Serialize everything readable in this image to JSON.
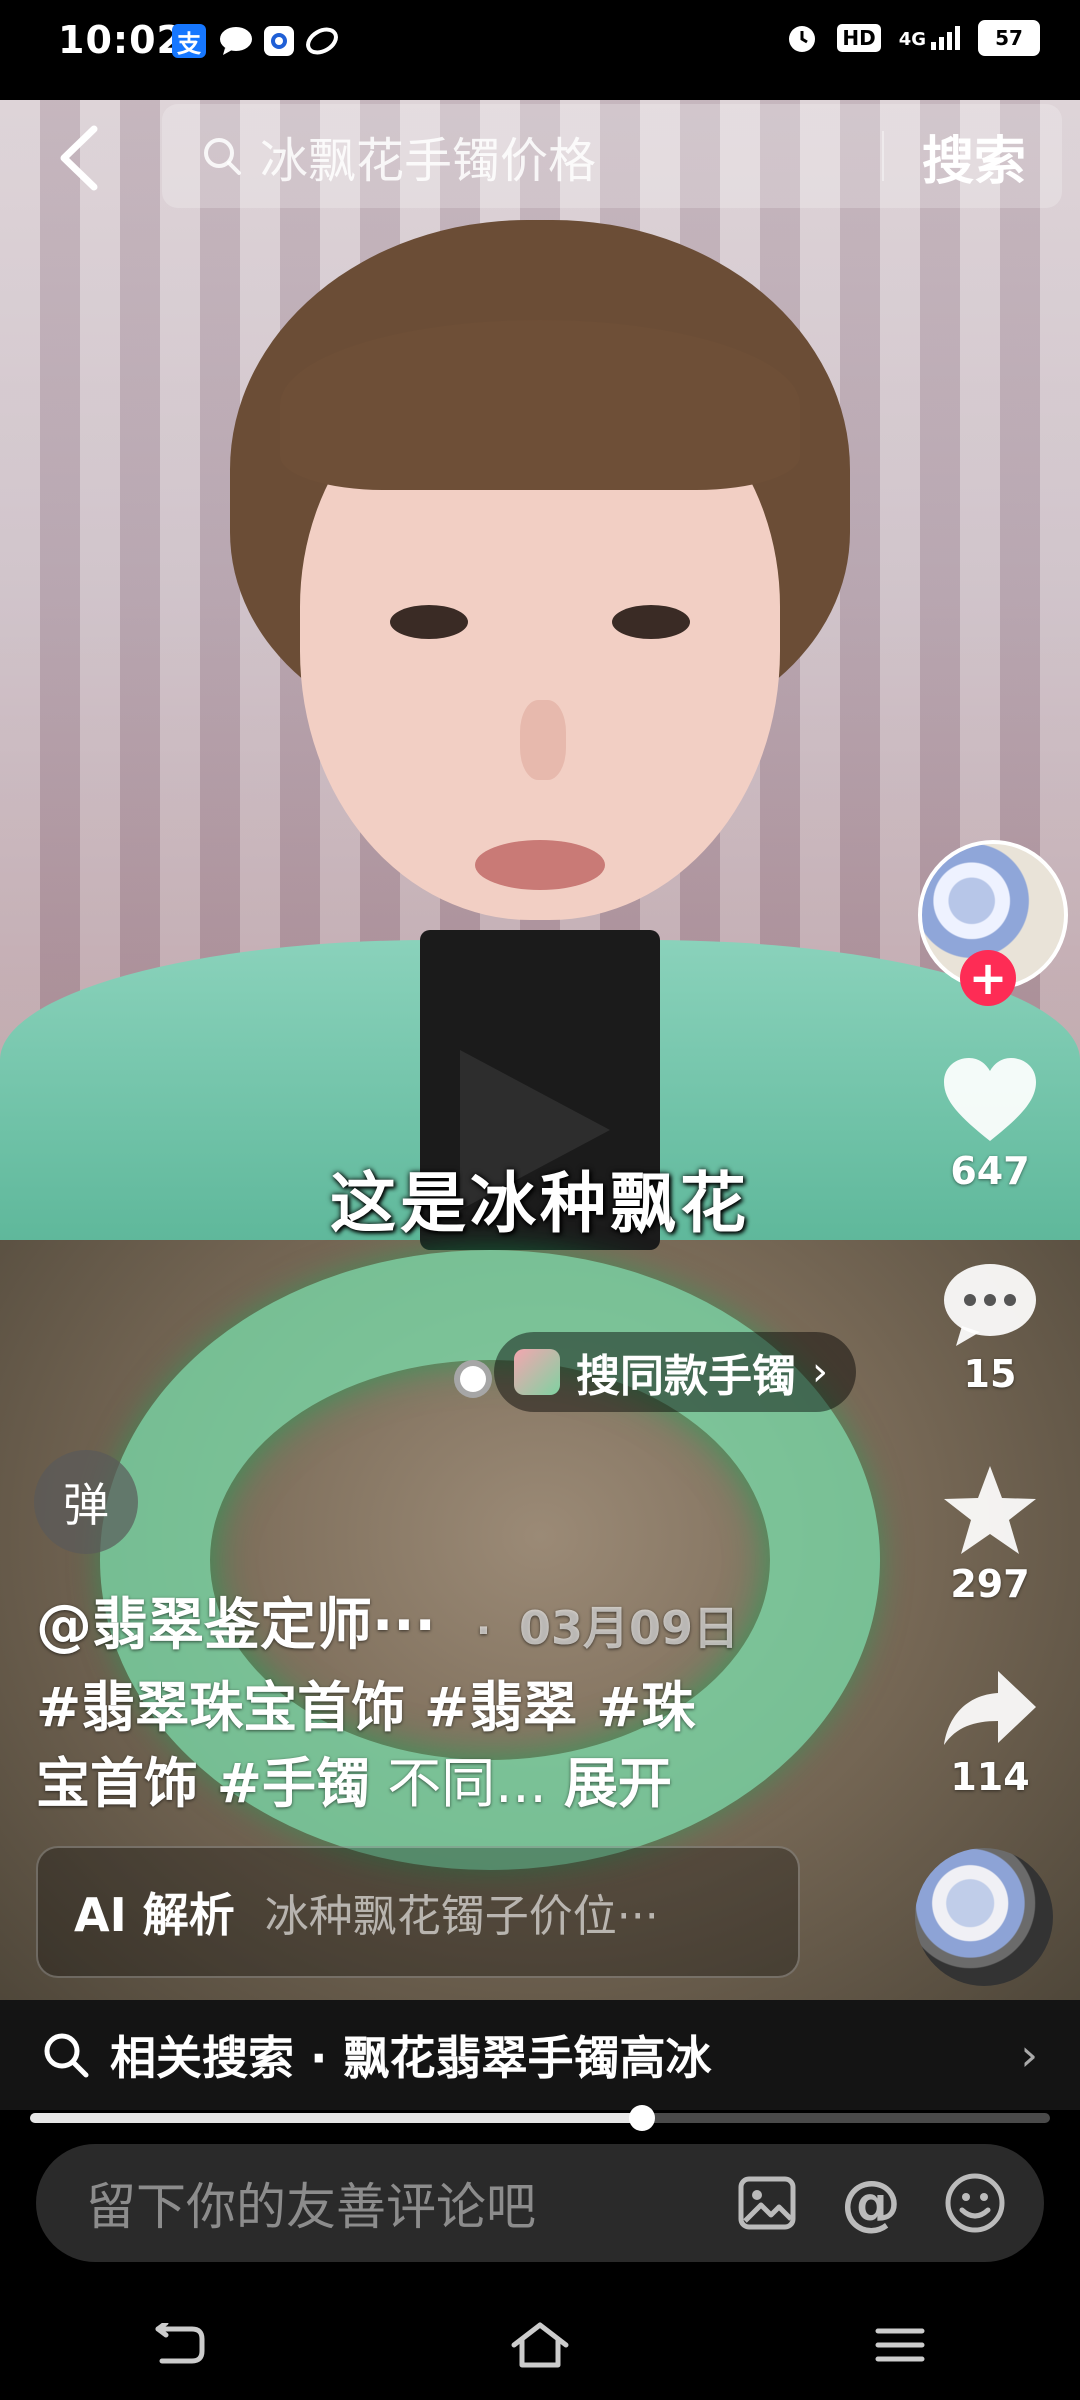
{
  "status_bar": {
    "time": "10:02",
    "app_icons": [
      "alipay-icon",
      "chat-bubble-icon",
      "app-square-icon",
      "leaf-icon"
    ],
    "right_icons": [
      "alarm-icon",
      "hd-icon",
      "signal-4g-icon"
    ],
    "hd_label": "HD",
    "network_label": "4G",
    "battery": "57"
  },
  "search": {
    "query": "冰飘花手镯价格",
    "button": "搜索"
  },
  "video": {
    "caption": "这是冰种飘花"
  },
  "actions": {
    "likes": "647",
    "comments": "15",
    "favorites": "297",
    "shares": "114"
  },
  "product_tag": {
    "label": "搜同款手镯"
  },
  "danmu_label": "弹",
  "post": {
    "author": "@翡翠鉴定师···",
    "date": "03月09日",
    "tags_line1": "#翡翠珠宝首饰 #翡翠 #珠",
    "tags_line2": "宝首饰 #手镯",
    "tail_text": " 不同... ",
    "expand": "展开"
  },
  "ai_summary": {
    "label": "AI 解析",
    "text": "冰种飘花镯子价位···"
  },
  "related_search": {
    "text": "相关搜索 · 飘花翡翠手镯高冰"
  },
  "progress": {
    "played_fraction": 0.6
  },
  "comment_bar": {
    "placeholder": "留下你的友善评论吧"
  },
  "colors": {
    "accent_red": "#fe2c55",
    "background": "#000000"
  }
}
